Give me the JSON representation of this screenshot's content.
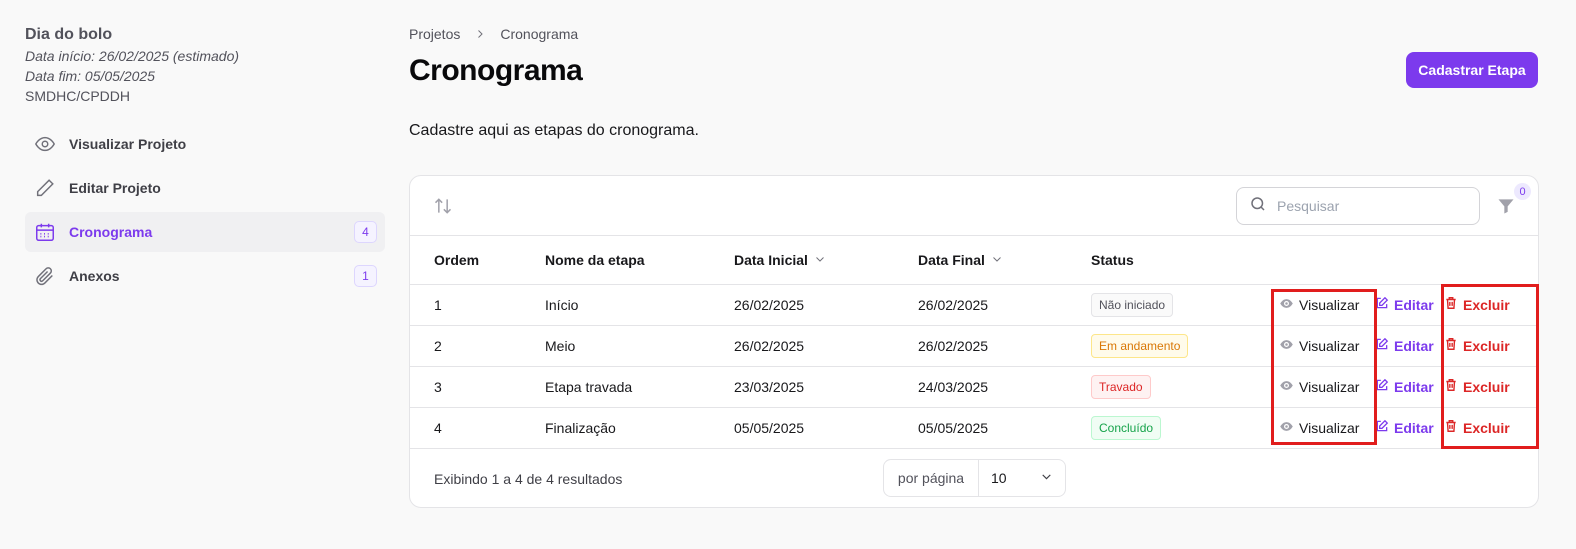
{
  "project": {
    "name": "Dia do bolo",
    "start": "Data início: 26/02/2025 (estimado)",
    "end": "Data fim: 05/05/2025",
    "org": "SMDHC/CPDDH"
  },
  "nav": {
    "view": "Visualizar Projeto",
    "edit": "Editar Projeto",
    "schedule": "Cronograma",
    "schedule_count": "4",
    "attachments": "Anexos",
    "attachments_count": "1"
  },
  "breadcrumb": {
    "root": "Projetos",
    "current": "Cronograma"
  },
  "header": {
    "title": "Cronograma",
    "primary_button": "Cadastrar Etapa",
    "subtitle": "Cadastre aqui as etapas do cronograma."
  },
  "toolbar": {
    "search_placeholder": "Pesquisar",
    "filter_count": "0"
  },
  "table": {
    "columns": {
      "ordem": "Ordem",
      "nome": "Nome da etapa",
      "inicio": "Data Inicial",
      "fim": "Data Final",
      "status": "Status"
    },
    "actions": {
      "view": "Visualizar",
      "edit": "Editar",
      "delete": "Excluir"
    },
    "rows": [
      {
        "ordem": "1",
        "nome": "Início",
        "inicio": "26/02/2025",
        "fim": "26/02/2025",
        "status": "Não iniciado"
      },
      {
        "ordem": "2",
        "nome": "Meio",
        "inicio": "26/02/2025",
        "fim": "26/02/2025",
        "status": "Em andamento"
      },
      {
        "ordem": "3",
        "nome": "Etapa travada",
        "inicio": "23/03/2025",
        "fim": "24/03/2025",
        "status": "Travado"
      },
      {
        "ordem": "4",
        "nome": "Finalização",
        "inicio": "05/05/2025",
        "fim": "05/05/2025",
        "status": "Concluído"
      }
    ]
  },
  "footer": {
    "results": "Exibindo 1 a 4 de 4 resultados",
    "per_page_label": "por página",
    "per_page_value": "10"
  },
  "colors": {
    "accent": "#7c3aed",
    "danger": "#dc2626",
    "highlight": "#e11d1d"
  }
}
